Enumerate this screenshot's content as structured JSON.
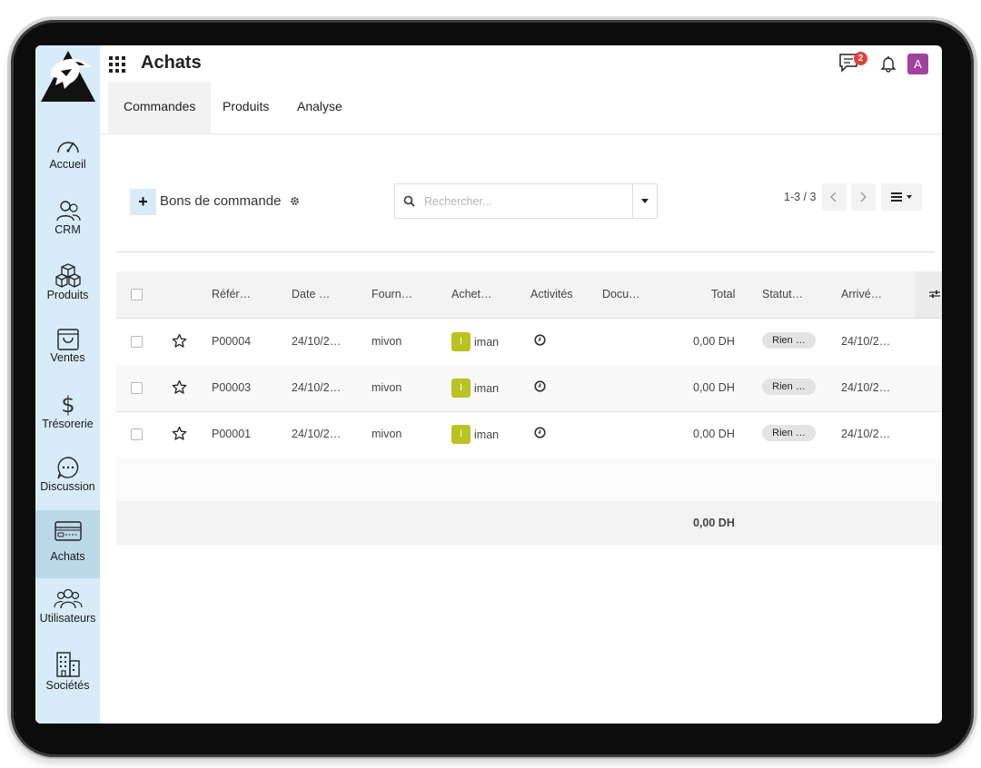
{
  "app": {
    "title": "Achats"
  },
  "header": {
    "notification_count": "2",
    "user_initial": "A"
  },
  "tabs": [
    {
      "label": "Commandes",
      "active": true
    },
    {
      "label": "Produits",
      "active": false
    },
    {
      "label": "Analyse",
      "active": false
    }
  ],
  "sidebar": {
    "items": [
      {
        "label": "Accueil",
        "icon": "gauge-icon"
      },
      {
        "label": "CRM",
        "icon": "users-icon"
      },
      {
        "label": "Produits",
        "icon": "boxes-icon"
      },
      {
        "label": "Ventes",
        "icon": "shopping-bag-icon"
      },
      {
        "label": "Trésorerie",
        "icon": "dollar-icon"
      },
      {
        "label": "Discussion",
        "icon": "chat-bubble-icon"
      },
      {
        "label": "Achats",
        "icon": "card-icon",
        "active": true
      },
      {
        "label": "Utilisateurs",
        "icon": "group-icon"
      },
      {
        "label": "Sociétés",
        "icon": "buildings-icon"
      }
    ]
  },
  "control": {
    "new_label": "+",
    "breadcrumb": "Bons de commande",
    "search_placeholder": "Rechercher...",
    "pager": "1-3 / 3"
  },
  "table": {
    "columns": [
      "Référ…",
      "Date …",
      "Fourn…",
      "Achet…",
      "Activités",
      "Docu…",
      "Total",
      "Statut…",
      "Arrivé…"
    ],
    "rows": [
      {
        "ref": "P00004",
        "date": "24/10/2…",
        "supplier": "mivon",
        "buyer_initial": "I",
        "buyer": "iman",
        "total": "0,00 DH",
        "status": "Rien …",
        "arrival": "24/10/2…"
      },
      {
        "ref": "P00003",
        "date": "24/10/2…",
        "supplier": "mivon",
        "buyer_initial": "I",
        "buyer": "iman",
        "total": "0,00 DH",
        "status": "Rien …",
        "arrival": "24/10/2…"
      },
      {
        "ref": "P00001",
        "date": "24/10/2…",
        "supplier": "mivon",
        "buyer_initial": "I",
        "buyer": "iman",
        "total": "0,00 DH",
        "status": "Rien …",
        "arrival": "24/10/2…"
      }
    ],
    "sum_total": "0,00 DH"
  },
  "colors": {
    "sidebar_bg": "#d7ecf8",
    "avatar": "#a1429f",
    "buyer_avatar": "#b9c322",
    "badge": "#e0403b"
  }
}
